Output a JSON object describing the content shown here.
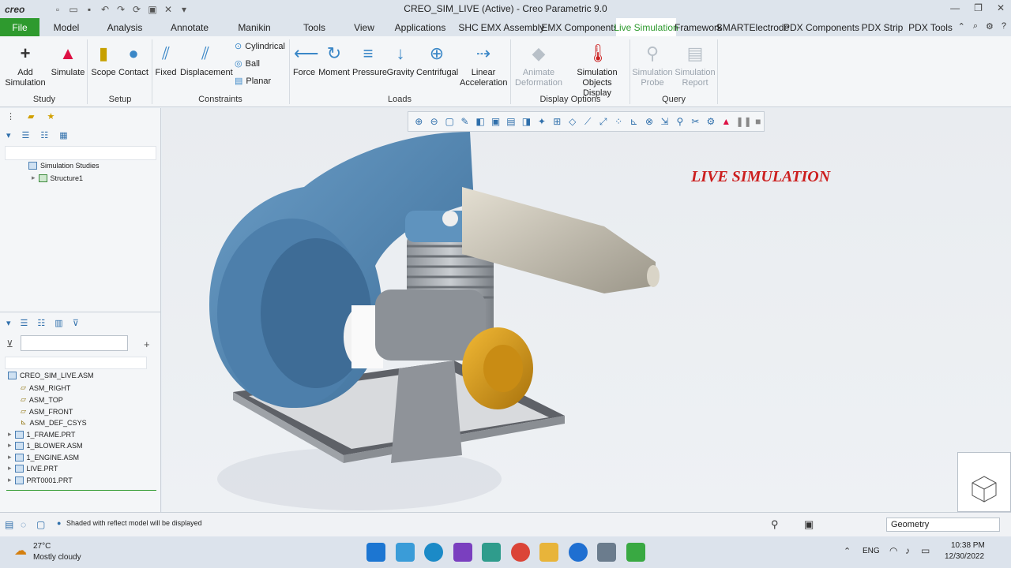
{
  "titlebar": {
    "logo": "creo",
    "title": "CREO_SIM_LIVE (Active) - Creo Parametric 9.0"
  },
  "menubar": {
    "file": "File",
    "tabs": [
      "Model",
      "Analysis",
      "Annotate",
      "Manikin",
      "Tools",
      "View",
      "Applications",
      "SHC",
      "EMX Assembly",
      "EMX Components",
      "Live Simulation",
      "Framework",
      "SMARTElectrode",
      "PDX Components",
      "PDX Strip",
      "PDX Tools"
    ]
  },
  "ribbon": {
    "add_simulation": "Add Simulation",
    "simulate": "Simulate",
    "scope": "Scope",
    "contact": "Contact",
    "fixed": "Fixed",
    "displacement": "Displacement",
    "cylindrical": "Cylindrical",
    "ball": "Ball",
    "planar": "Planar",
    "force": "Force",
    "moment": "Moment",
    "pressure": "Pressure",
    "gravity": "Gravity",
    "centrifugal": "Centrifugal",
    "linear_acceleration": "Linear Acceleration",
    "animate_deformation": "Animate Deformation",
    "simulation_objects_display": "Simulation Objects Display",
    "simulation_probe": "Simulation Probe",
    "simulation_report": "Simulation Report",
    "groups": {
      "study": "Study",
      "setup": "Setup",
      "constraints": "Constraints",
      "loads": "Loads",
      "display_options": "Display Options",
      "query": "Query"
    }
  },
  "simtree": {
    "root": "Simulation Studies",
    "child": "Structure1"
  },
  "model_tree": {
    "items": [
      "CREO_SIM_LIVE.ASM",
      "ASM_RIGHT",
      "ASM_TOP",
      "ASM_FRONT",
      "ASM_DEF_CSYS",
      "1_FRAME.PRT",
      "1_BLOWER.ASM",
      "1_ENGINE.ASM",
      "LIVE.PRT",
      "PRT0001.PRT"
    ]
  },
  "viewport": {
    "label": "LIVE SIMULATION"
  },
  "status": {
    "message": "Shaded with reflect model will be displayed",
    "filter": "Geometry"
  },
  "taskbar": {
    "temp": "27°C",
    "weather": "Mostly cloudy",
    "lang": "ENG",
    "time": "10:38 PM",
    "date": "12/30/2022"
  }
}
